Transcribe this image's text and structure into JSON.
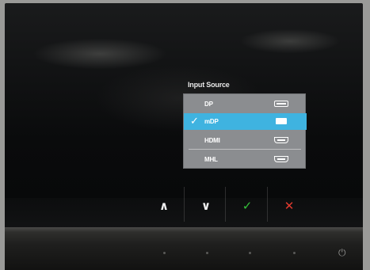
{
  "osd": {
    "title": "Input Source",
    "items": [
      {
        "label": "DP",
        "icon": "displayport-icon",
        "selected": false
      },
      {
        "label": "mDP",
        "icon": "mini-displayport-icon",
        "selected": true
      },
      {
        "label": "HDMI",
        "icon": "hdmi-icon",
        "selected": false
      },
      {
        "label": "MHL",
        "icon": "hdmi-icon",
        "selected": false
      }
    ],
    "selected_check": "✓",
    "colors": {
      "highlight": "#3fb3e0",
      "panel": "#8b8d90"
    }
  },
  "buttons": {
    "up": "∧",
    "down": "∨",
    "ok": "✓",
    "cancel": "✕",
    "power": "⏻"
  },
  "colors": {
    "ok": "#35c13a",
    "cancel": "#e23a2f"
  }
}
